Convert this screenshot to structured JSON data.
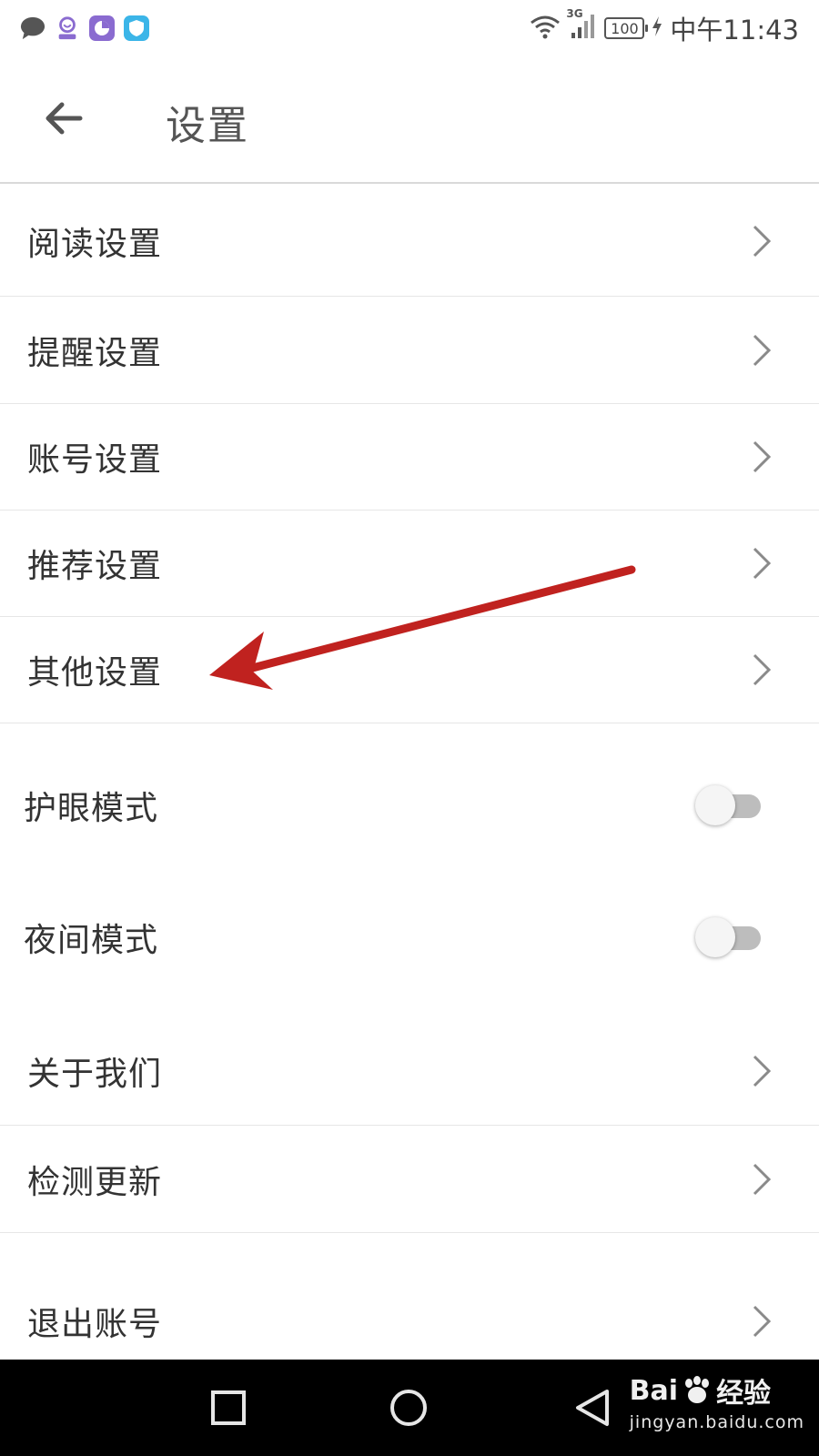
{
  "status_bar": {
    "time": "中午11:43",
    "battery": "100",
    "network": "3G",
    "apps": [
      "message-app",
      "profile-app",
      "chart-app",
      "shield-app"
    ]
  },
  "header": {
    "title": "设置"
  },
  "menu": {
    "items": [
      {
        "label": "阅读设置"
      },
      {
        "label": "提醒设置"
      },
      {
        "label": "账号设置"
      },
      {
        "label": "推荐设置"
      },
      {
        "label": "其他设置"
      }
    ]
  },
  "toggles": {
    "eye_mode": {
      "label": "护眼模式",
      "enabled": false
    },
    "night_mode": {
      "label": "夜间模式",
      "enabled": false
    }
  },
  "more": {
    "items": [
      {
        "label": "关于我们"
      },
      {
        "label": "检测更新"
      },
      {
        "label": "退出账号"
      }
    ]
  },
  "watermark": {
    "main_left": "Bai",
    "main_right": "经验",
    "sub": "jingyan.baidu.com"
  },
  "colors": {
    "annotation_arrow": "#c0221f",
    "toggle_track": "#bdbdbd",
    "nav_bar": "#000000"
  }
}
